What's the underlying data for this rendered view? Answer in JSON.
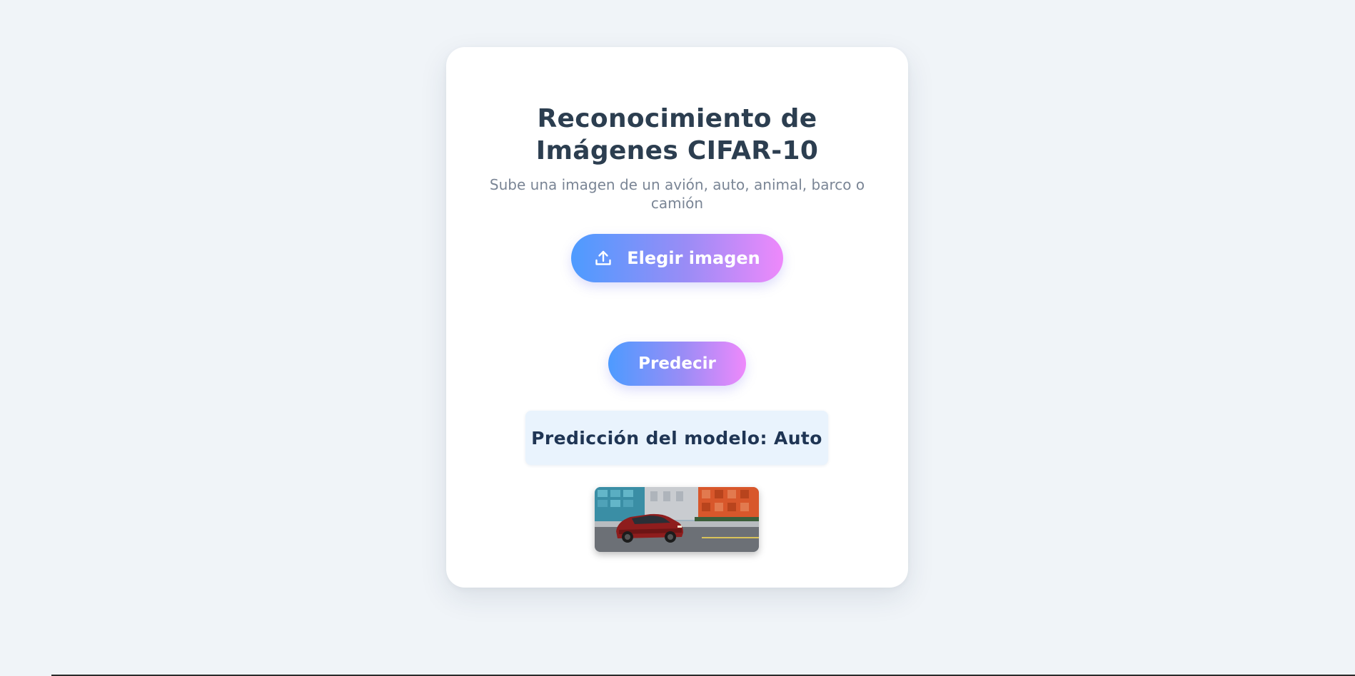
{
  "page": {
    "title_line1": "Reconocimiento de",
    "title_line2": "Imágenes CIFAR-10",
    "subtitle": "Sube una imagen de un avión, auto, animal, barco o camión"
  },
  "upload": {
    "icon": "upload-icon",
    "label": "Elegir imagen"
  },
  "predict": {
    "label": "Predecir"
  },
  "result": {
    "text": "Predicción del modelo: Auto"
  },
  "preview": {
    "description": "uploaded car photo preview"
  },
  "colors": {
    "background": "#f0f4f8",
    "card": "#ffffff",
    "gradient_start": "#4d9bff",
    "gradient_end": "#ee89fb",
    "title": "#2c3e50",
    "subtitle": "#7a8595",
    "result_bg": "#e9f3fd",
    "result_text": "#1f3554"
  }
}
